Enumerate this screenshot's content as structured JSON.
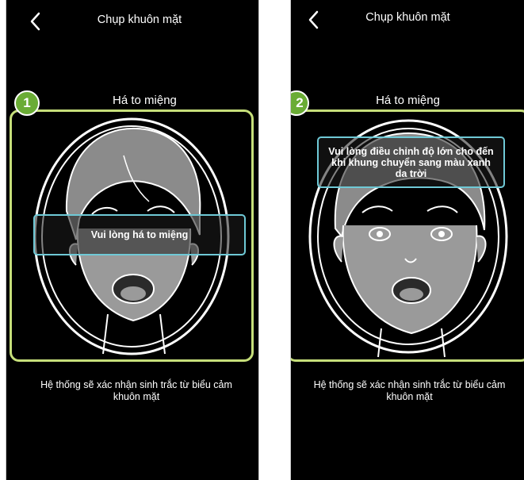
{
  "screens": [
    {
      "step_number": "1",
      "title": "Chụp khuôn mặt",
      "instruction": "Há to miệng",
      "message": "Vui lòng há to miệng",
      "footnote": "Hệ thống sẽ xác nhận sinh trắc từ biểu cảm khuôn mặt"
    },
    {
      "step_number": "2",
      "title": "Chụp khuôn mặt",
      "instruction": "Há to miệng",
      "message": "Vui lòng điều chỉnh độ lớn cho đến khi khung chuyển sang màu xanh da trời",
      "footnote": "Hệ thống sẽ xác nhận sinh trắc từ biểu cảm khuôn mặt"
    }
  ],
  "colors": {
    "screen_background": "#000000",
    "frame_highlight": "#c6df7a",
    "step_badge": "#6aac35",
    "message_border": "#6fc9d6"
  },
  "icons": [
    "back-icon",
    "face-illustration"
  ]
}
